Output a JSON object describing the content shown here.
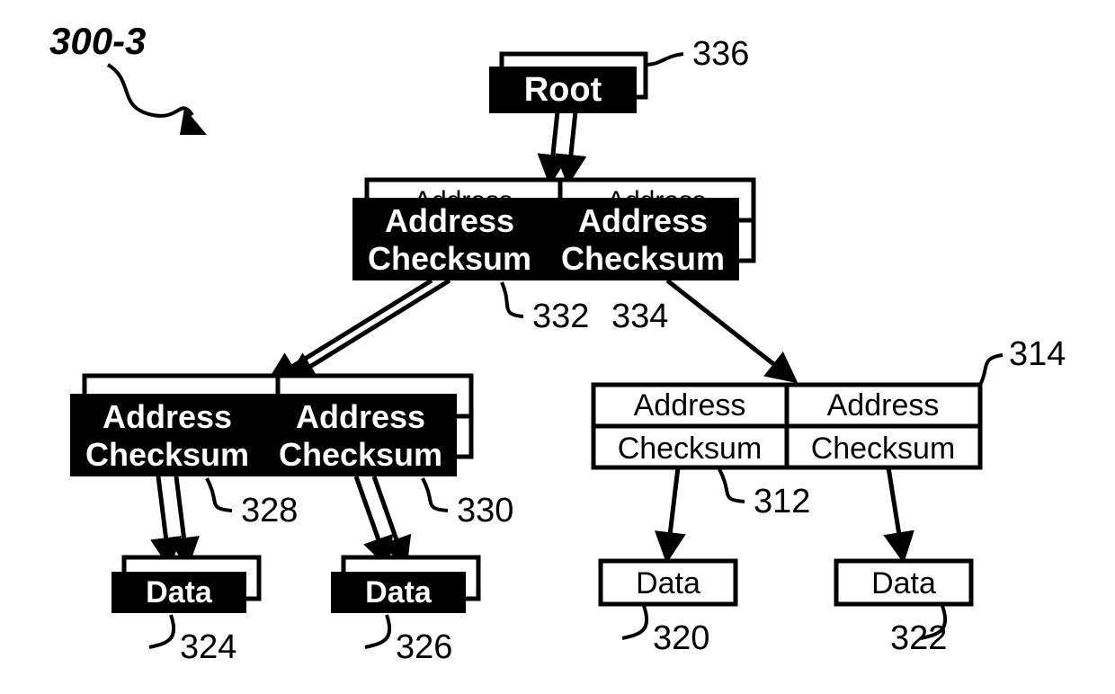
{
  "figure_ref": "300-3",
  "root": {
    "label": "Root",
    "ref": "336"
  },
  "level1": {
    "left": {
      "top": "Address",
      "bottom": "Checksum",
      "ref": "332"
    },
    "right": {
      "top": "Address",
      "bottom": "Checksum",
      "ref": "334"
    }
  },
  "level2_left": {
    "left": {
      "top": "Address",
      "bottom": "Checksum",
      "ref": "328"
    },
    "right": {
      "top": "Address",
      "bottom": "Checksum",
      "ref": "330"
    }
  },
  "level2_right": {
    "left": {
      "top": "Address",
      "bottom": "Checksum",
      "ref": "312"
    },
    "right": {
      "top": "Address",
      "bottom": "Checksum"
    },
    "ref": "314"
  },
  "leaves": {
    "d324": {
      "label": "Data",
      "ref": "324"
    },
    "d326": {
      "label": "Data",
      "ref": "326"
    },
    "d320": {
      "label": "Data",
      "ref": "320"
    },
    "d322": {
      "label": "Data",
      "ref": "322"
    }
  }
}
